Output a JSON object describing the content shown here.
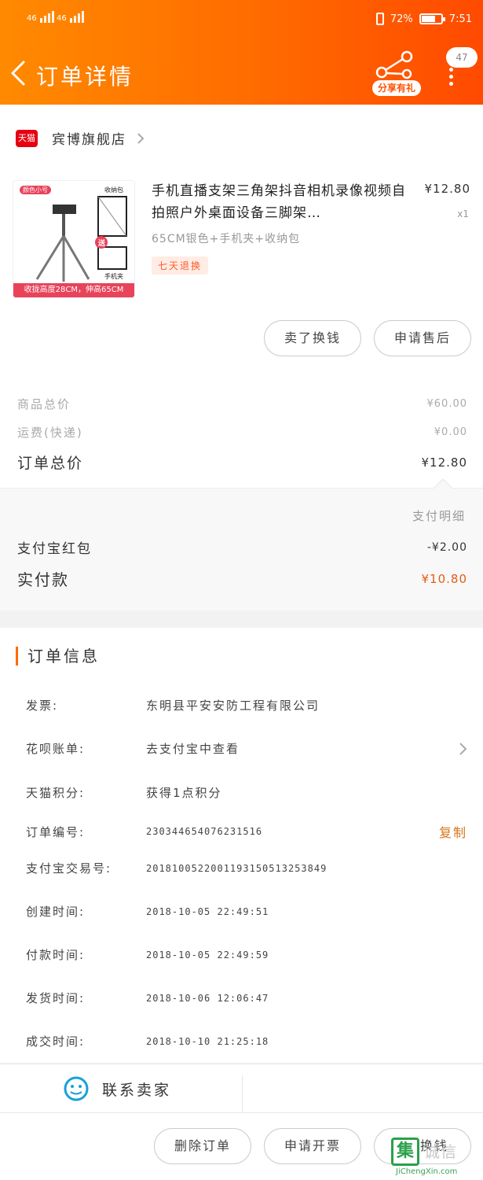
{
  "status": {
    "network_left": "46",
    "network_right": "46",
    "battery": "72%",
    "battery_level": 0.72,
    "time": "7:51"
  },
  "header": {
    "title": "订单详情",
    "share_label": "分享有礼",
    "message_count": "47"
  },
  "store": {
    "badge": "天猫",
    "name": "宾博旗舰店"
  },
  "product": {
    "name": "手机直播支架三角架抖音相机录像视频自拍照户外桌面设备三脚架…",
    "price": "¥12.80",
    "qty": "x1",
    "spec": "65CM银色+手机夹+收纳包",
    "service_badge": "七天退换",
    "thumb_tag": "颜色小号",
    "thumb_label_bag": "收纳包",
    "thumb_label_gift": "送",
    "thumb_label_clip": "手机夹",
    "thumb_caption": "收拢高度28CM，伸高65CM"
  },
  "actions": {
    "sold_exchange": "卖了换钱",
    "after_sale": "申请售后"
  },
  "summary": {
    "goods_total_label": "商品总价",
    "goods_total": "¥60.00",
    "shipping_label": "运费(快递)",
    "shipping": "¥0.00",
    "order_total_label": "订单总价",
    "order_total": "¥12.80"
  },
  "payment": {
    "detail_label": "支付明细",
    "redpacket_label": "支付宝红包",
    "redpacket": "-¥2.00",
    "paid_label": "实付款",
    "paid": "¥10.80"
  },
  "order_info": {
    "title": "订单信息",
    "rows": [
      {
        "key": "发票:",
        "value": "东明县平安安防工程有限公司"
      },
      {
        "key": "花呗账单:",
        "value": "去支付宝中查看"
      },
      {
        "key": "天猫积分:",
        "value": "获得1点积分"
      },
      {
        "key": "订单编号:",
        "value": "230344654076231516",
        "action": "复制"
      },
      {
        "key": "支付宝交易号:",
        "value": "2018100522001193150513253849"
      },
      {
        "key": "创建时间:",
        "value": "2018-10-05 22:49:51"
      },
      {
        "key": "付款时间:",
        "value": "2018-10-05 22:49:59"
      },
      {
        "key": "发货时间:",
        "value": "2018-10-06 12:06:47"
      },
      {
        "key": "成交时间:",
        "value": "2018-10-10 21:25:18"
      }
    ]
  },
  "contact": {
    "label": "联系卖家"
  },
  "bottom": {
    "delete_order": "删除订单",
    "invoice": "申请开票",
    "exchange": "换钱"
  },
  "watermark": {
    "mark": "集",
    "text": "诚信",
    "url": "JiChengXin.com"
  },
  "colors": {
    "header_start": "#ff8a00",
    "header_end": "#ff4a00",
    "accent": "#ff6a00",
    "paid": "#e35e17",
    "tmall": "#e60012"
  }
}
